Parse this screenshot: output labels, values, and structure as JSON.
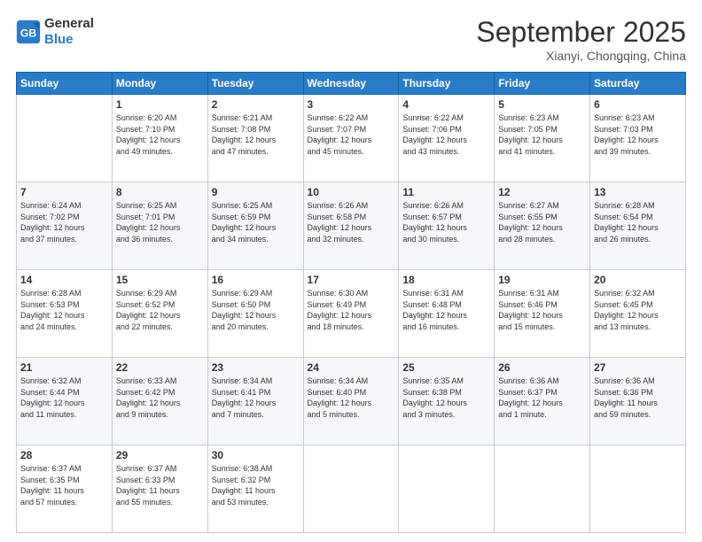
{
  "header": {
    "logo_line1": "General",
    "logo_line2": "Blue",
    "month": "September 2025",
    "location": "Xianyi, Chongqing, China"
  },
  "weekdays": [
    "Sunday",
    "Monday",
    "Tuesday",
    "Wednesday",
    "Thursday",
    "Friday",
    "Saturday"
  ],
  "weeks": [
    [
      {
        "day": "",
        "info": ""
      },
      {
        "day": "1",
        "info": "Sunrise: 6:20 AM\nSunset: 7:10 PM\nDaylight: 12 hours\nand 49 minutes."
      },
      {
        "day": "2",
        "info": "Sunrise: 6:21 AM\nSunset: 7:08 PM\nDaylight: 12 hours\nand 47 minutes."
      },
      {
        "day": "3",
        "info": "Sunrise: 6:22 AM\nSunset: 7:07 PM\nDaylight: 12 hours\nand 45 minutes."
      },
      {
        "day": "4",
        "info": "Sunrise: 6:22 AM\nSunset: 7:06 PM\nDaylight: 12 hours\nand 43 minutes."
      },
      {
        "day": "5",
        "info": "Sunrise: 6:23 AM\nSunset: 7:05 PM\nDaylight: 12 hours\nand 41 minutes."
      },
      {
        "day": "6",
        "info": "Sunrise: 6:23 AM\nSunset: 7:03 PM\nDaylight: 12 hours\nand 39 minutes."
      }
    ],
    [
      {
        "day": "7",
        "info": "Sunrise: 6:24 AM\nSunset: 7:02 PM\nDaylight: 12 hours\nand 37 minutes."
      },
      {
        "day": "8",
        "info": "Sunrise: 6:25 AM\nSunset: 7:01 PM\nDaylight: 12 hours\nand 36 minutes."
      },
      {
        "day": "9",
        "info": "Sunrise: 6:25 AM\nSunset: 6:59 PM\nDaylight: 12 hours\nand 34 minutes."
      },
      {
        "day": "10",
        "info": "Sunrise: 6:26 AM\nSunset: 6:58 PM\nDaylight: 12 hours\nand 32 minutes."
      },
      {
        "day": "11",
        "info": "Sunrise: 6:26 AM\nSunset: 6:57 PM\nDaylight: 12 hours\nand 30 minutes."
      },
      {
        "day": "12",
        "info": "Sunrise: 6:27 AM\nSunset: 6:55 PM\nDaylight: 12 hours\nand 28 minutes."
      },
      {
        "day": "13",
        "info": "Sunrise: 6:28 AM\nSunset: 6:54 PM\nDaylight: 12 hours\nand 26 minutes."
      }
    ],
    [
      {
        "day": "14",
        "info": "Sunrise: 6:28 AM\nSunset: 6:53 PM\nDaylight: 12 hours\nand 24 minutes."
      },
      {
        "day": "15",
        "info": "Sunrise: 6:29 AM\nSunset: 6:52 PM\nDaylight: 12 hours\nand 22 minutes."
      },
      {
        "day": "16",
        "info": "Sunrise: 6:29 AM\nSunset: 6:50 PM\nDaylight: 12 hours\nand 20 minutes."
      },
      {
        "day": "17",
        "info": "Sunrise: 6:30 AM\nSunset: 6:49 PM\nDaylight: 12 hours\nand 18 minutes."
      },
      {
        "day": "18",
        "info": "Sunrise: 6:31 AM\nSunset: 6:48 PM\nDaylight: 12 hours\nand 16 minutes."
      },
      {
        "day": "19",
        "info": "Sunrise: 6:31 AM\nSunset: 6:46 PM\nDaylight: 12 hours\nand 15 minutes."
      },
      {
        "day": "20",
        "info": "Sunrise: 6:32 AM\nSunset: 6:45 PM\nDaylight: 12 hours\nand 13 minutes."
      }
    ],
    [
      {
        "day": "21",
        "info": "Sunrise: 6:32 AM\nSunset: 6:44 PM\nDaylight: 12 hours\nand 11 minutes."
      },
      {
        "day": "22",
        "info": "Sunrise: 6:33 AM\nSunset: 6:42 PM\nDaylight: 12 hours\nand 9 minutes."
      },
      {
        "day": "23",
        "info": "Sunrise: 6:34 AM\nSunset: 6:41 PM\nDaylight: 12 hours\nand 7 minutes."
      },
      {
        "day": "24",
        "info": "Sunrise: 6:34 AM\nSunset: 6:40 PM\nDaylight: 12 hours\nand 5 minutes."
      },
      {
        "day": "25",
        "info": "Sunrise: 6:35 AM\nSunset: 6:38 PM\nDaylight: 12 hours\nand 3 minutes."
      },
      {
        "day": "26",
        "info": "Sunrise: 6:36 AM\nSunset: 6:37 PM\nDaylight: 12 hours\nand 1 minute."
      },
      {
        "day": "27",
        "info": "Sunrise: 6:36 AM\nSunset: 6:36 PM\nDaylight: 11 hours\nand 59 minutes."
      }
    ],
    [
      {
        "day": "28",
        "info": "Sunrise: 6:37 AM\nSunset: 6:35 PM\nDaylight: 11 hours\nand 57 minutes."
      },
      {
        "day": "29",
        "info": "Sunrise: 6:37 AM\nSunset: 6:33 PM\nDaylight: 11 hours\nand 55 minutes."
      },
      {
        "day": "30",
        "info": "Sunrise: 6:38 AM\nSunset: 6:32 PM\nDaylight: 11 hours\nand 53 minutes."
      },
      {
        "day": "",
        "info": ""
      },
      {
        "day": "",
        "info": ""
      },
      {
        "day": "",
        "info": ""
      },
      {
        "day": "",
        "info": ""
      }
    ]
  ]
}
